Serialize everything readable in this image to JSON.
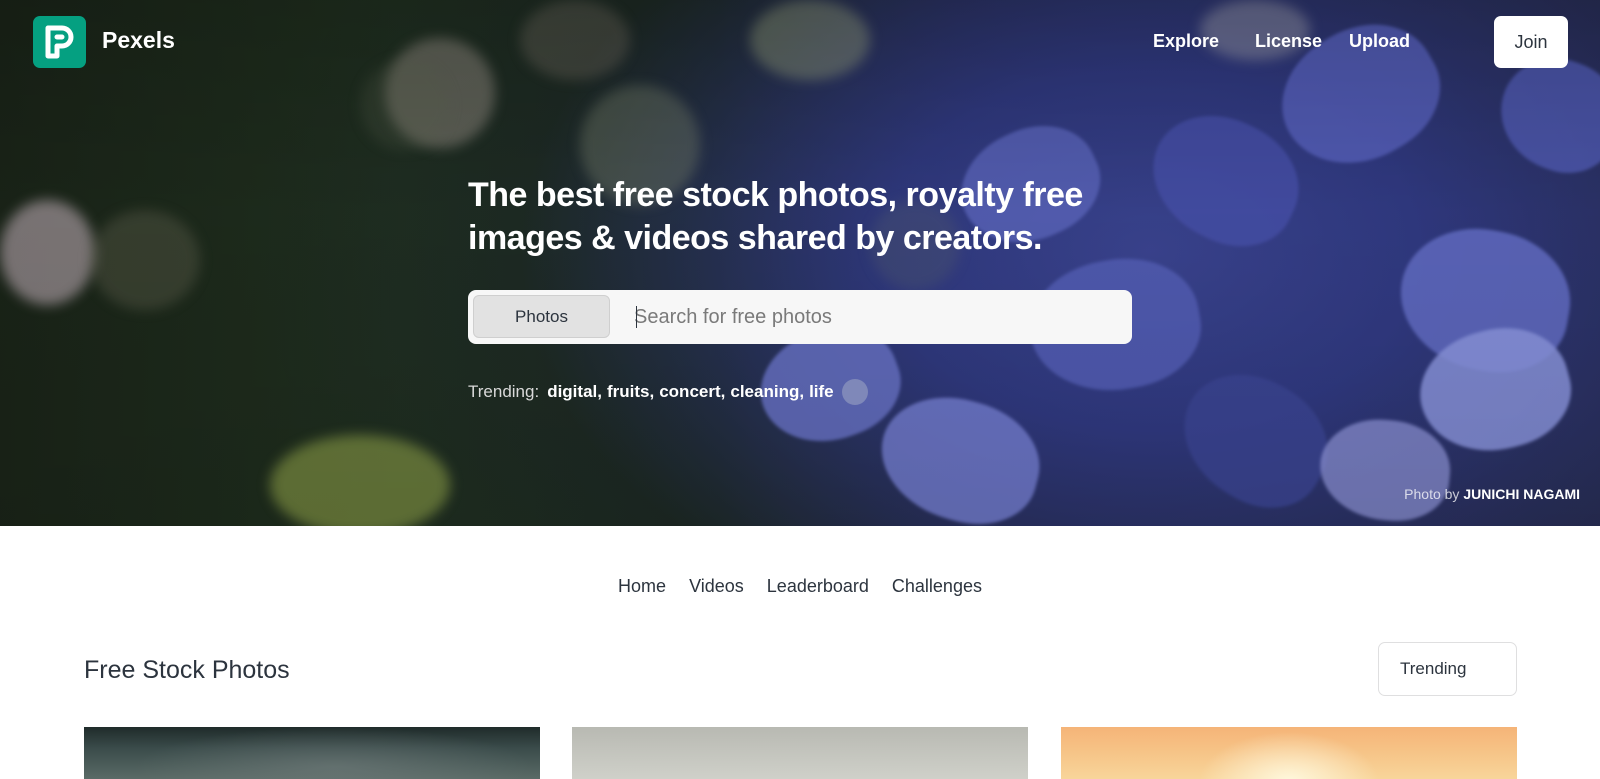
{
  "header": {
    "brand": "Pexels",
    "nav": {
      "explore": "Explore",
      "license": "License",
      "upload": "Upload"
    },
    "join_label": "Join"
  },
  "hero": {
    "headline_line1": "The best free stock photos, royalty free",
    "headline_line2": "images & videos shared by creators.",
    "search": {
      "type_label": "Photos",
      "placeholder": "Search for free photos"
    },
    "trending_label": "Trending:",
    "trending": [
      "digital",
      "fruits",
      "concert",
      "cleaning",
      "life"
    ],
    "credit_prefix": "Photo by",
    "credit_author": "JUNICHI NAGAMI"
  },
  "subnav": {
    "home": "Home",
    "videos": "Videos",
    "leaderboard": "Leaderboard",
    "challenges": "Challenges"
  },
  "section": {
    "title": "Free Stock Photos",
    "sort_label": "Trending"
  },
  "colors": {
    "brand": "#05a081"
  }
}
